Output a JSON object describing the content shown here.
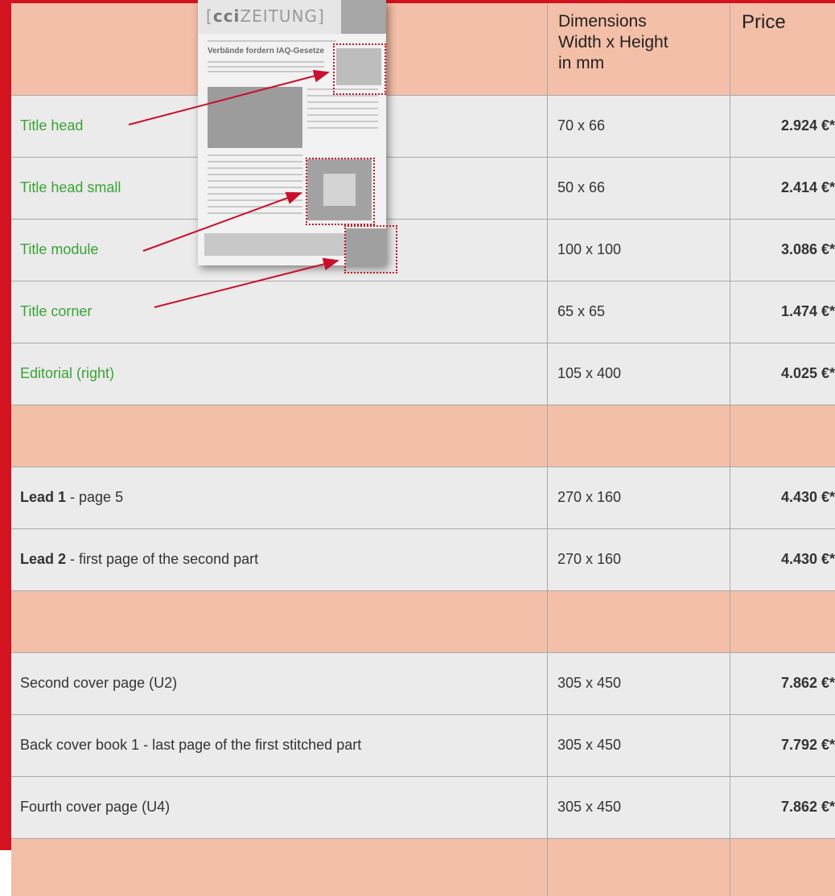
{
  "header": {
    "dimensions_label_1": "Dimensions",
    "dimensions_label_2": "Width x Height",
    "dimensions_label_3": "in mm",
    "price_label": "Price"
  },
  "thumbnail": {
    "logo_bold": "cci",
    "logo_rest": "ZEITUNG",
    "headline": "Verbände fordern IAQ-Gesetze"
  },
  "rows": [
    {
      "name": "Title head",
      "dims": "70 x 66",
      "price": "2.924 €*"
    },
    {
      "name": "Title head small",
      "dims": "50 x 66",
      "price": "2.414 €*"
    },
    {
      "name": "Title module",
      "dims": "100 x 100",
      "price": "3.086 €*"
    },
    {
      "name": "Title corner",
      "dims": "65 x 65",
      "price": "1.474 €*"
    },
    {
      "name": "Editorial (right)",
      "dims": "105 x 400",
      "price": "4.025 €*"
    },
    {
      "name_bold": "Lead 1",
      "name_rest": " - page 5",
      "dims": "270 x 160",
      "price": "4.430 €*"
    },
    {
      "name_bold": "Lead 2",
      "name_rest": " - first page of the second part",
      "dims": "270 x 160",
      "price": "4.430 €*"
    },
    {
      "name": "Second cover page (U2)",
      "dims": "305 x 450",
      "price": "7.862 €*"
    },
    {
      "name": "Back cover book 1 - last page of the first stitched part",
      "dims": "305 x 450",
      "price": "7.792 €*"
    },
    {
      "name": "Fourth cover page (U4)",
      "dims": "305 x 450",
      "price": "7.862 €*"
    }
  ],
  "colors": {
    "section_bg": "#f4bfa8",
    "row_bg": "#ebebeb",
    "accent_red": "#d3131f",
    "title_green": "#3aa335"
  }
}
